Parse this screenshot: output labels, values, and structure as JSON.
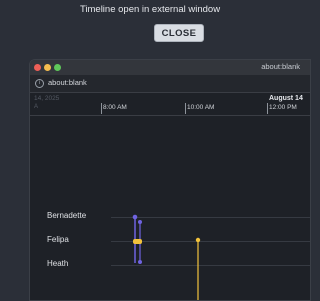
{
  "message": "Timeline open in external window",
  "close_button": "CLOSE",
  "window": {
    "title": "about:blank",
    "url": "about:blank"
  },
  "timeline": {
    "date_faded": "14, 2025",
    "date_current": "August 14",
    "ticks": [
      "8:00 AM",
      "10:00 AM",
      "12:00 PM"
    ],
    "rows": [
      "Bernadette",
      "Felipa",
      "Heath"
    ]
  },
  "colors": {
    "purple_event": "#6f63e0",
    "yellow_event": "#f2c23c"
  }
}
